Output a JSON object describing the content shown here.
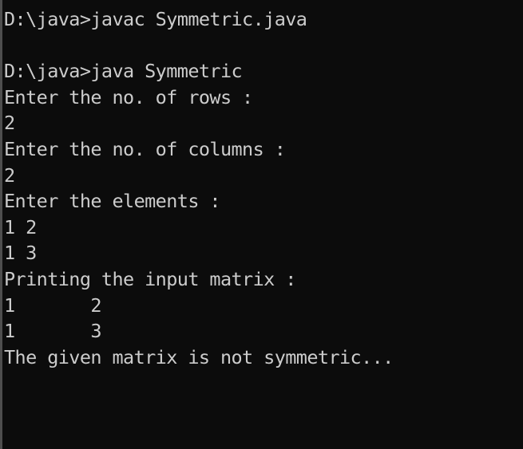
{
  "colors": {
    "background": "#0c0c0c",
    "foreground": "#cccccc"
  },
  "console": {
    "lines": [
      "D:\\java>javac Symmetric.java",
      "",
      "D:\\java>java Symmetric",
      "Enter the no. of rows :",
      "2",
      "Enter the no. of columns :",
      "2",
      "Enter the elements :",
      "1 2",
      "1 3",
      "Printing the input matrix :",
      "1       2",
      "1       3",
      "The given matrix is not symmetric..."
    ]
  }
}
